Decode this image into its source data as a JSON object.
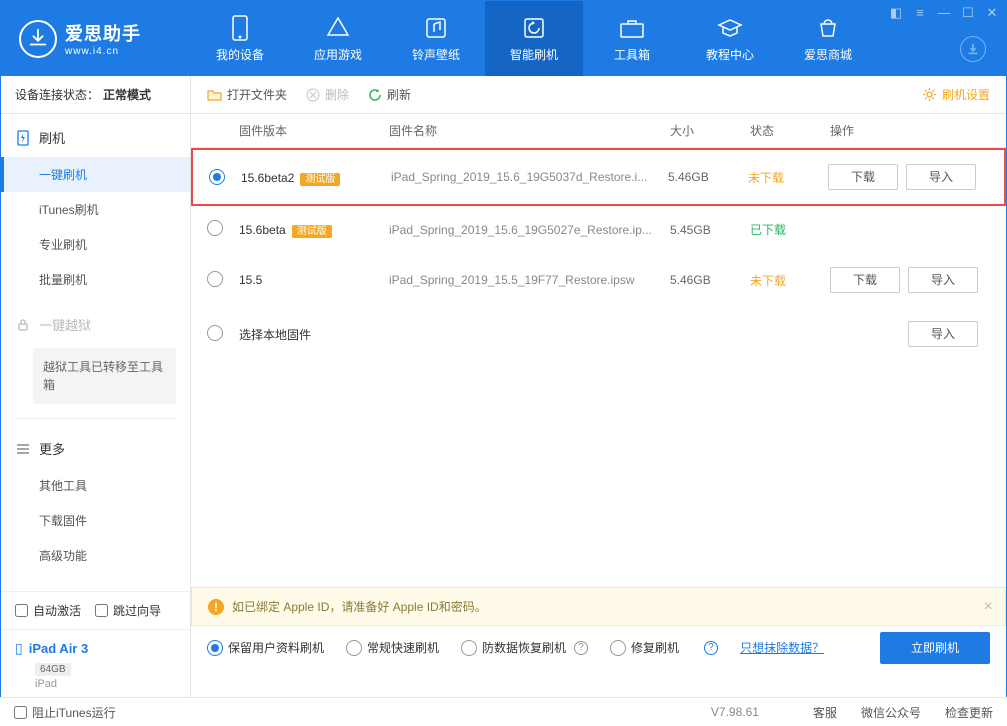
{
  "app": {
    "title": "爱思助手",
    "url": "www.i4.cn"
  },
  "nav": {
    "tabs": [
      {
        "label": "我的设备"
      },
      {
        "label": "应用游戏"
      },
      {
        "label": "铃声壁纸"
      },
      {
        "label": "智能刷机"
      },
      {
        "label": "工具箱"
      },
      {
        "label": "教程中心"
      },
      {
        "label": "爱思商城"
      }
    ]
  },
  "sidebar": {
    "conn_label": "设备连接状态：",
    "conn_value": "正常模式",
    "flash": {
      "title": "刷机",
      "items": [
        "一键刷机",
        "iTunes刷机",
        "专业刷机",
        "批量刷机"
      ]
    },
    "jailbreak": {
      "title": "一键越狱",
      "note": "越狱工具已转移至工具箱"
    },
    "more": {
      "title": "更多",
      "items": [
        "其他工具",
        "下载固件",
        "高级功能"
      ]
    },
    "auto_activate": "自动激活",
    "skip_guide": "跳过向导",
    "device": {
      "name": "iPad Air 3",
      "capacity": "64GB",
      "type": "iPad"
    }
  },
  "toolbar": {
    "open": "打开文件夹",
    "delete": "删除",
    "refresh": "刷新",
    "settings": "刷机设置"
  },
  "table": {
    "headers": {
      "version": "固件版本",
      "name": "固件名称",
      "size": "大小",
      "status": "状态",
      "action": "操作"
    },
    "rows": [
      {
        "version": "15.6beta2",
        "beta": "测试版",
        "name": "iPad_Spring_2019_15.6_19G5037d_Restore.i...",
        "size": "5.46GB",
        "status": "未下载",
        "status_class": "undl",
        "selected": true,
        "actions": [
          "下载",
          "导入"
        ],
        "highlight": true
      },
      {
        "version": "15.6beta",
        "beta": "测试版",
        "name": "iPad_Spring_2019_15.6_19G5027e_Restore.ip...",
        "size": "5.45GB",
        "status": "已下载",
        "status_class": "dl",
        "selected": false,
        "actions": []
      },
      {
        "version": "15.5",
        "beta": "",
        "name": "iPad_Spring_2019_15.5_19F77_Restore.ipsw",
        "size": "5.46GB",
        "status": "未下载",
        "status_class": "undl",
        "selected": false,
        "actions": [
          "下载",
          "导入"
        ]
      }
    ],
    "local_row": {
      "label": "选择本地固件",
      "action": "导入"
    }
  },
  "notice": "如已绑定 Apple ID，请准备好 Apple ID和密码。",
  "bottom": {
    "opts": [
      "保留用户资料刷机",
      "常规快速刷机",
      "防数据恢复刷机",
      "修复刷机"
    ],
    "erase_link": "只想抹除数据？",
    "flash_btn": "立即刷机"
  },
  "footer": {
    "block_itunes": "阻止iTunes运行",
    "version": "V7.98.61",
    "links": [
      "客服",
      "微信公众号",
      "检查更新"
    ]
  }
}
